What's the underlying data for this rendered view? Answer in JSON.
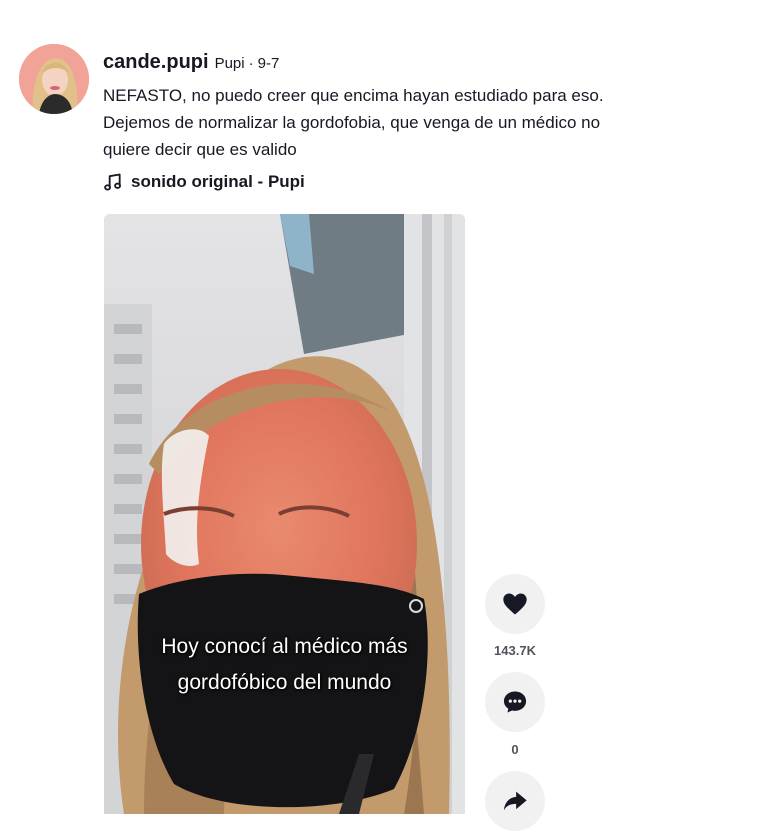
{
  "post": {
    "username": "cande.pupi",
    "nickname": "Pupi",
    "separator": "·",
    "date": "9-7",
    "caption_lines": [
      "NEFASTO, no puedo creer que encima hayan estudiado para eso.",
      "Dejemos de normalizar la gordofobia, que venga de un médico no",
      "quiere decir que es valido"
    ],
    "music": "sonido original - Pupi"
  },
  "video": {
    "subtitle_lines": [
      "Hoy conocí al médico más",
      "gordofóbico del mundo"
    ]
  },
  "actions": {
    "like_count": "143.7K",
    "comment_count": "0"
  },
  "icons": {
    "like": "heart-icon",
    "comment": "comment-bubble-icon",
    "share": "share-arrow-icon",
    "music": "music-note-icon"
  },
  "colors": {
    "text": "#161823",
    "action_bg": "#f1f1f2"
  }
}
